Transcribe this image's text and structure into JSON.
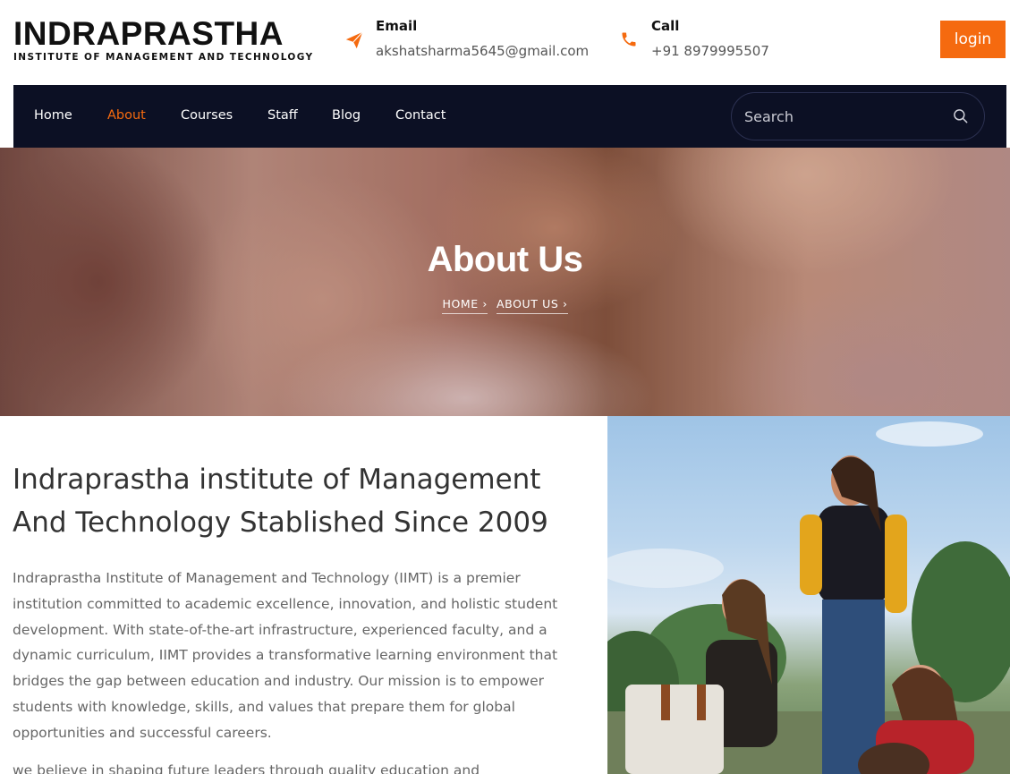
{
  "brand": {
    "title": "INDRAPRASTHA",
    "subtitle": "INSTITUTE OF MANAGEMENT AND TECHNOLOGY"
  },
  "contact": {
    "email_label": "Email",
    "email_value": "akshatsharma5645@gmail.com",
    "email_icon": "paper-plane-icon",
    "call_label": "Call",
    "call_value": "+91 8979995507",
    "call_icon": "phone-icon"
  },
  "header": {
    "login_label": "login"
  },
  "nav": {
    "items": [
      {
        "label": "Home",
        "active": false
      },
      {
        "label": "About",
        "active": true
      },
      {
        "label": "Courses",
        "active": false
      },
      {
        "label": "Staff",
        "active": false
      },
      {
        "label": "Blog",
        "active": false
      },
      {
        "label": "Contact",
        "active": false
      }
    ],
    "search_placeholder": "Search"
  },
  "hero": {
    "title": "About Us",
    "breadcrumb": [
      "HOME",
      "ABOUT US"
    ]
  },
  "about": {
    "heading": "Indraprastha institute of Management And Technology Stablished Since 2009",
    "paragraph": "Indraprastha Institute of Management and Technology (IIMT) is a premier institution committed to academic excellence, innovation, and holistic student development. With state-of-the-art infrastructure, experienced faculty, and a dynamic curriculum, IIMT provides a transformative learning environment that bridges the gap between education and industry. Our mission is to empower students with knowledge, skills, and values that prepare them for global opportunities and successful careers.",
    "paragraph2": "we believe in shaping future leaders through quality education and"
  },
  "colors": {
    "accent": "#f56a0f",
    "nav_bg": "#0c1024"
  }
}
